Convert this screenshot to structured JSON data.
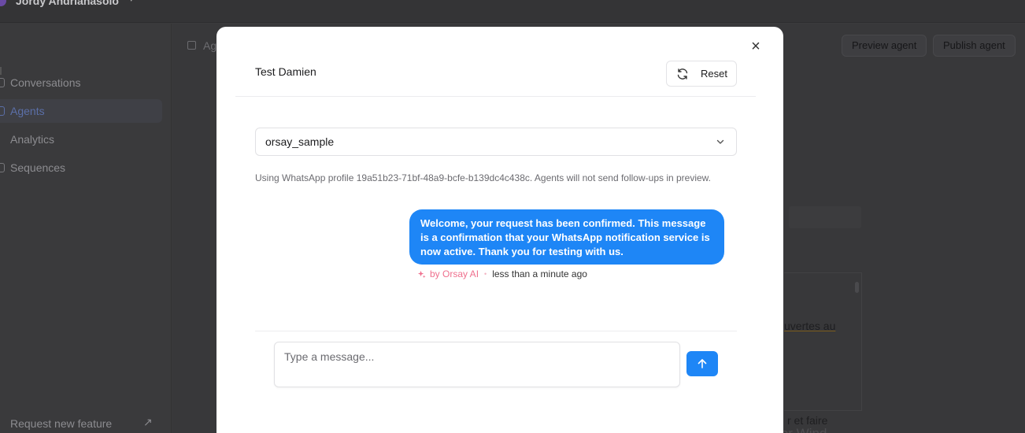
{
  "background": {
    "user_name": "Jordy Andrianasolo",
    "sidebar": {
      "items": [
        {
          "label": "Conversations",
          "active": false
        },
        {
          "label": "Agents",
          "active": true
        },
        {
          "label": "Analytics",
          "active": false
        },
        {
          "label": "Sequences",
          "active": false
        }
      ],
      "request_feature_label": "Request new feature"
    },
    "breadcrumb_text": "Ag",
    "preview_agent_label": "Preview agent",
    "publish_agent_label": "Publish agent",
    "editor_snippet_1": "uvertes au",
    "editor_snippet_2": "r et faire",
    "watermark_text": "Activer Wind"
  },
  "modal": {
    "title": "Test Damien",
    "reset_label": "Reset",
    "close_symbol": "×",
    "select_value": "orsay_sample",
    "info_text": "Using WhatsApp profile 19a51b23-71bf-48a9-bcfe-b139dc4c438c. Agents will not send follow-ups in preview.",
    "message": {
      "text": "Welcome, your request has been confirmed. This message is a confirmation that your WhatsApp notification service is now active. Thank you for testing with us.",
      "by_label": "by Orsay AI",
      "separator": "•",
      "time": "less than a minute ago"
    },
    "input_placeholder": "Type a message..."
  },
  "colors": {
    "accent": "#1e86f6",
    "ai_label": "#ef6f8d",
    "overlay": "#3a3a3c"
  }
}
